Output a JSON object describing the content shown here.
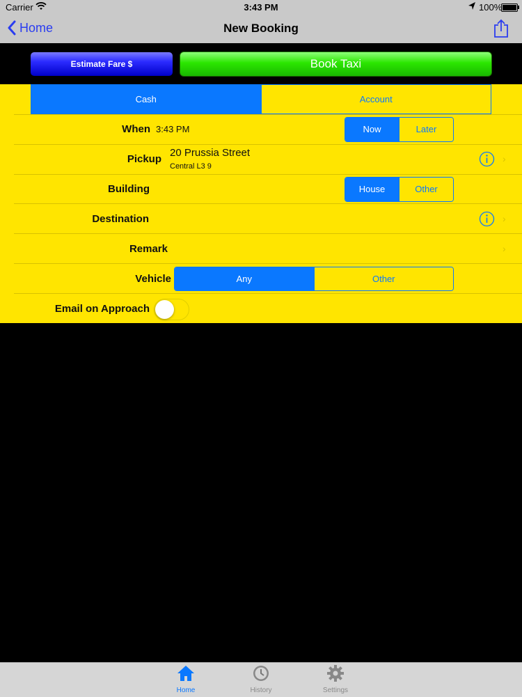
{
  "status_bar": {
    "carrier": "Carrier",
    "time": "3:43 PM",
    "battery": "100%"
  },
  "nav": {
    "back_label": "Home",
    "title": "New Booking"
  },
  "actions": {
    "estimate_label": "Estimate Fare $",
    "book_label": "Book Taxi"
  },
  "payment": {
    "options": [
      "Cash",
      "Account"
    ],
    "selected": "Cash"
  },
  "when": {
    "label": "When",
    "value": "3:43 PM",
    "options": [
      "Now",
      "Later"
    ],
    "selected": "Now"
  },
  "pickup": {
    "label": "Pickup",
    "line1": "20 Prussia Street",
    "line2": "Central L3 9"
  },
  "building": {
    "label": "Building",
    "options": [
      "House",
      "Other"
    ],
    "selected": "House"
  },
  "destination": {
    "label": "Destination"
  },
  "remark": {
    "label": "Remark"
  },
  "vehicle": {
    "label": "Vehicle",
    "options": [
      "Any",
      "Other"
    ],
    "selected": "Any"
  },
  "email_approach": {
    "label": "Email on Approach",
    "enabled": false
  },
  "tabs": [
    {
      "label": "Home",
      "icon": "home-icon",
      "active": true
    },
    {
      "label": "History",
      "icon": "clock-icon",
      "active": false
    },
    {
      "label": "Settings",
      "icon": "gear-icon",
      "active": false
    }
  ],
  "colors": {
    "accent": "#0a78ff",
    "panel": "#ffe500",
    "book": "#2be600",
    "estimate": "#2b2bff",
    "nav_link": "#2a3cf0"
  }
}
